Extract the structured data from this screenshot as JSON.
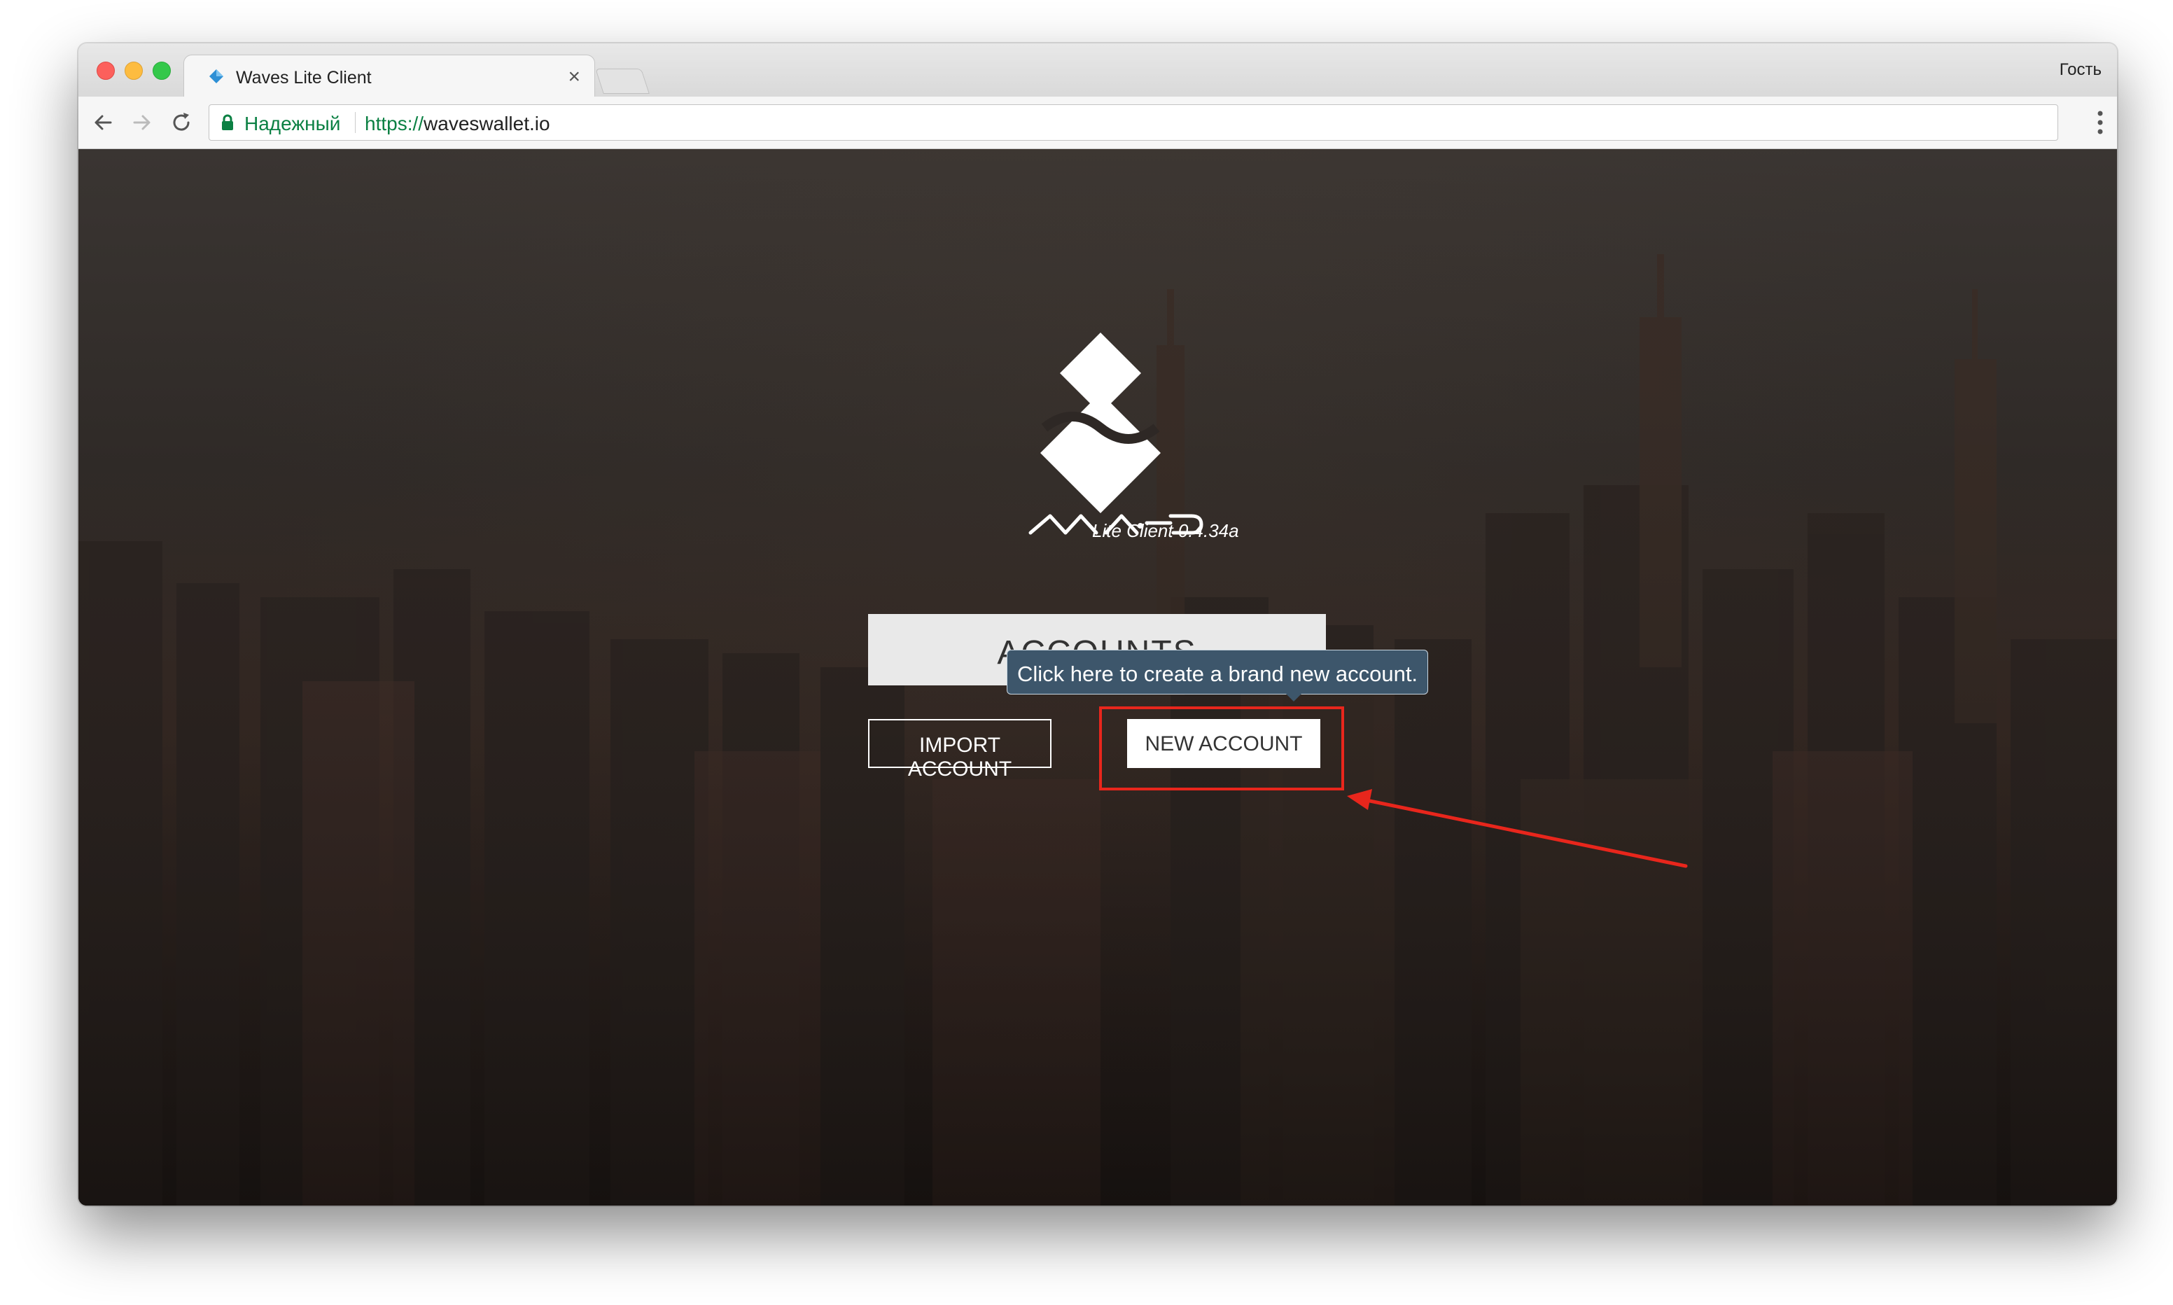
{
  "browser": {
    "tab_title": "Waves Lite Client",
    "tab_close": "×",
    "profile_label": "Гость",
    "secure_label": "Надежный",
    "url_scheme": "https://",
    "url_host": "waveswallet.io"
  },
  "app": {
    "version": "Lite Client 0.4.34a",
    "accounts_title": "ACCOUNTS",
    "tooltip": "Click here to create a brand new account.",
    "import_label": "IMPORT ACCOUNT",
    "new_label": "NEW ACCOUNT"
  },
  "colors": {
    "highlight": "#e8261c",
    "tooltip_bg": "#3d566b",
    "secure_green": "#0b8043"
  }
}
